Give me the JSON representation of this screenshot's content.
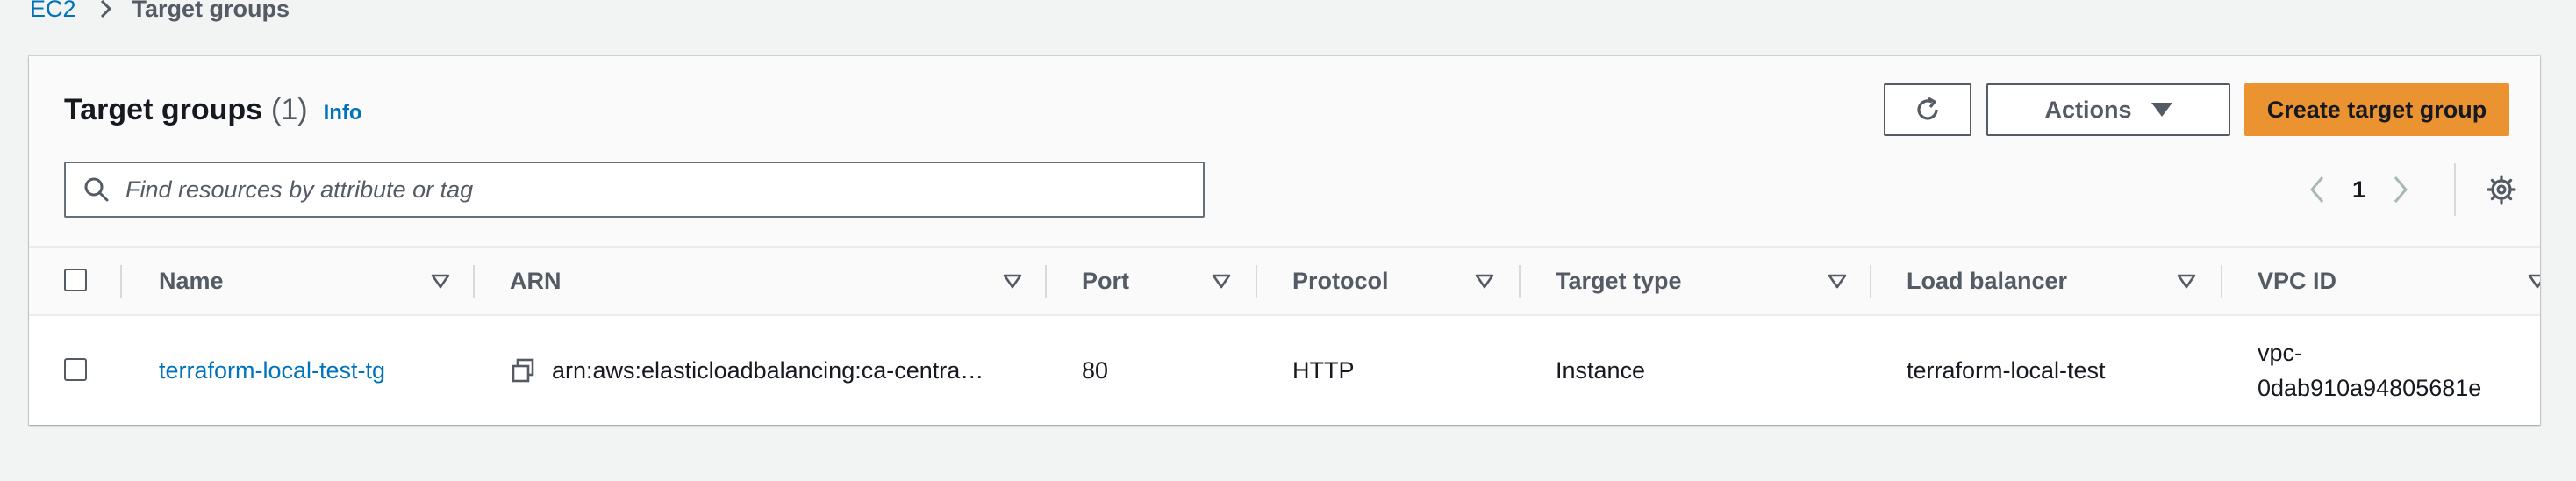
{
  "breadcrumb": {
    "items": [
      "EC2",
      "Target groups"
    ]
  },
  "panel": {
    "title": "Target groups",
    "count": "(1)",
    "info_label": "Info"
  },
  "toolbar": {
    "actions_label": "Actions",
    "create_label": "Create target group"
  },
  "search": {
    "placeholder": "Find resources by attribute or tag",
    "value": ""
  },
  "pagination": {
    "current_page": "1"
  },
  "table": {
    "columns": [
      "Name",
      "ARN",
      "Port",
      "Protocol",
      "Target type",
      "Load balancer",
      "VPC ID"
    ],
    "rows": [
      {
        "name": "terraform-local-test-tg",
        "arn": "arn:aws:elasticloadbalancing:ca-centra…",
        "port": "80",
        "protocol": "HTTP",
        "target_type": "Instance",
        "load_balancer": "terraform-local-test",
        "vpc_id_line1": "vpc-",
        "vpc_id_line2": "0dab910a94805681e"
      }
    ]
  },
  "colors": {
    "link": "#0073bb",
    "primary_button": "#ec9331",
    "background": "#f2f3f3",
    "text": "#16191f",
    "muted_text": "#545b64"
  },
  "icons": [
    "chevron-right-icon",
    "refresh-icon",
    "caret-down-icon",
    "search-icon",
    "chevron-left-icon",
    "settings-gear-icon",
    "sort-caret-icon",
    "copy-icon"
  ]
}
